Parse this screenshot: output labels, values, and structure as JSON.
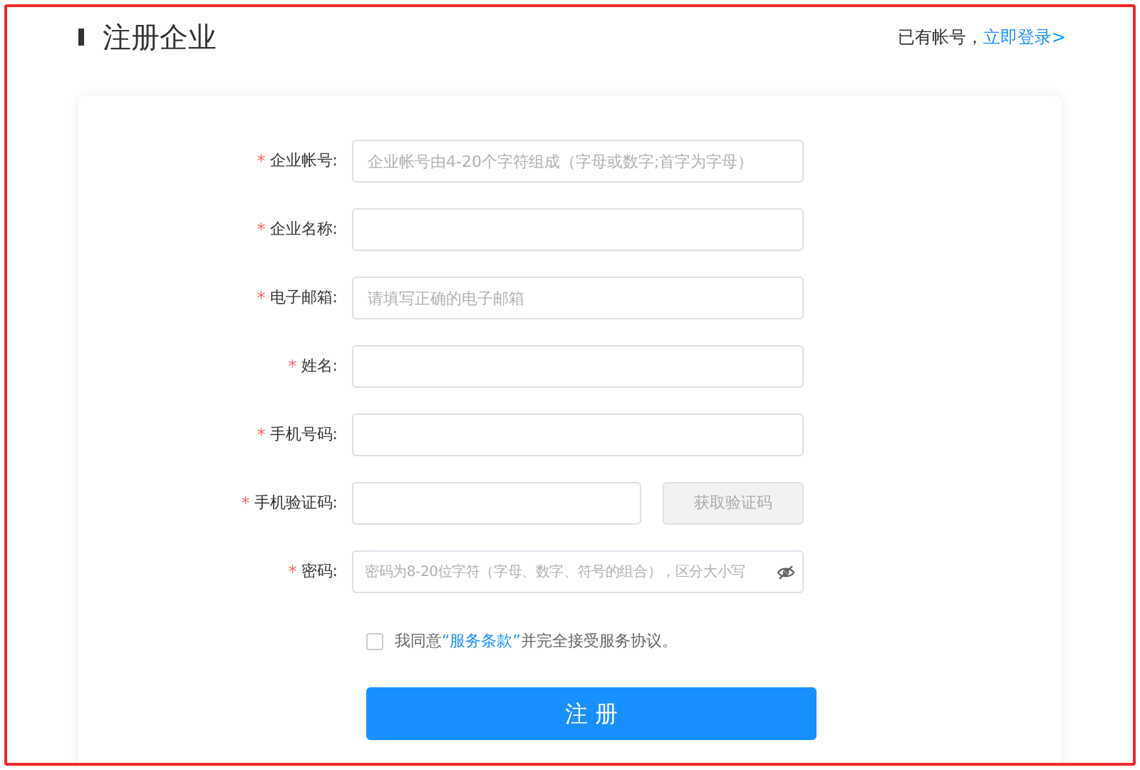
{
  "header": {
    "title": "注册企业",
    "prompt": "已有帐号，",
    "login_link": "立即登录>"
  },
  "fields": [
    {
      "kind": "text",
      "required_mark": "*",
      "label": "企业帐号:",
      "placeholder": "企业帐号由4-20个字符组成（字母或数字;首字为字母）"
    },
    {
      "kind": "text",
      "required_mark": "*",
      "label": "企业名称:"
    },
    {
      "kind": "text",
      "required_mark": "*",
      "label": "电子邮箱:",
      "placeholder": "请填写正确的电子邮箱"
    },
    {
      "kind": "text",
      "required_mark": "*",
      "label": "姓名:"
    },
    {
      "kind": "text",
      "required_mark": "*",
      "label": "手机号码:"
    },
    {
      "kind": "code",
      "required_mark": "*",
      "label": "手机验证码:",
      "button": "获取验证码",
      "button_disabled": true
    },
    {
      "kind": "password",
      "required_mark": "*",
      "label": "密码:",
      "placeholder": "密码为8-20位字符（字母、数字、符号的组合），区分大小写"
    }
  ],
  "agreement": {
    "checked": false,
    "before": "我同意",
    "link": "“服务条款”",
    "after": "并完全接受服务协议。"
  },
  "submit": "注 册"
}
